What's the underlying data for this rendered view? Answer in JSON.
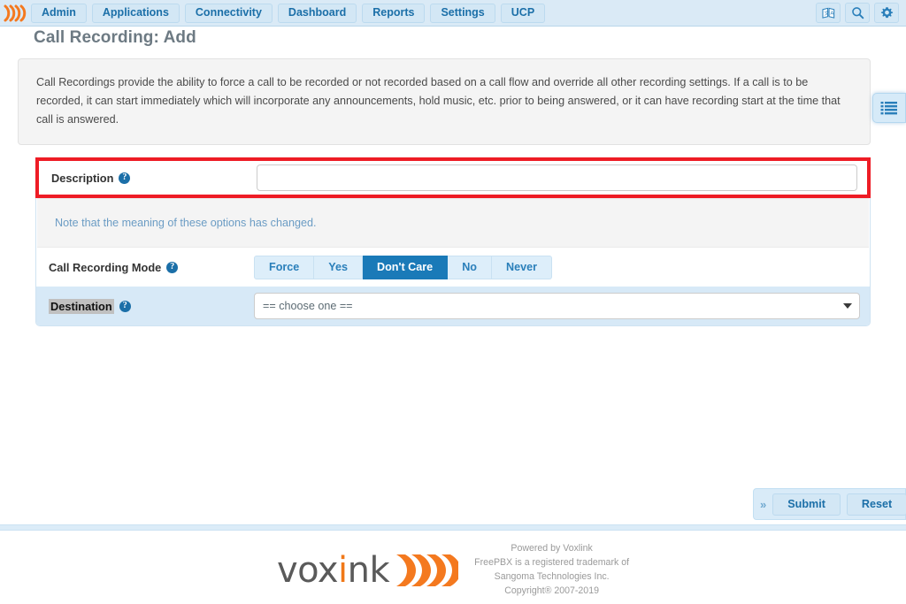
{
  "navbar": {
    "brand_icon": "voxlink-swoosh-logo",
    "items": [
      {
        "label": "Admin"
      },
      {
        "label": "Applications"
      },
      {
        "label": "Connectivity"
      },
      {
        "label": "Dashboard"
      },
      {
        "label": "Reports"
      },
      {
        "label": "Settings"
      },
      {
        "label": "UCP"
      }
    ],
    "right_icons": [
      {
        "name": "translate-icon"
      },
      {
        "name": "search-icon"
      },
      {
        "name": "gear-icon"
      }
    ]
  },
  "page": {
    "title": "Call Recording: Add"
  },
  "info": {
    "text": "Call Recordings provide the ability to force a call to be recorded or not recorded based on a call flow and override all other recording settings. If a call is to be recorded, it can start immediately which will incorporate any announcements, hold music, etc. prior to being answered, or it can have recording start at the time that call is answered."
  },
  "form": {
    "description": {
      "label": "Description",
      "help_icon": "question-mark-icon",
      "value": "",
      "placeholder": "",
      "highlight_color": "#ee1c25"
    },
    "note": {
      "text": "Note that the meaning of these options has changed."
    },
    "call_recording_mode": {
      "label": "Call Recording Mode",
      "help_icon": "question-mark-icon",
      "options": [
        "Force",
        "Yes",
        "Don't Care",
        "No",
        "Never"
      ],
      "selected": "Don't Care",
      "active_color": "#1a7ab8"
    },
    "destination": {
      "label": "Destination",
      "help_icon": "question-mark-icon",
      "selected": "== choose one ==",
      "options": [
        "== choose one =="
      ]
    }
  },
  "side_tab": {
    "icon": "list-menu-icon"
  },
  "actions": {
    "chevron": "»",
    "submit_label": "Submit",
    "reset_label": "Reset"
  },
  "footer": {
    "logo_text_1": "vox",
    "logo_text_i": "i",
    "logo_text_2": "nk",
    "logo_icon": "voxlink-swoosh-logo",
    "line1": "Powered by Voxlink",
    "line2": "FreePBX is a registered trademark of",
    "line3": "Sangoma Technologies Inc.",
    "line4": "Copyright® 2007-2019"
  }
}
